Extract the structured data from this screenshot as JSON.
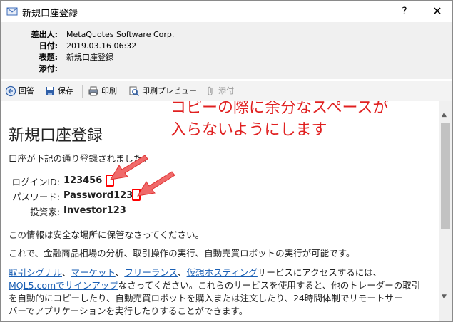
{
  "window": {
    "title": "新規口座登録",
    "help_label": "?",
    "close_label": "✕"
  },
  "header": {
    "from_label": "差出人:",
    "from_value": "MetaQuotes Software Corp.",
    "date_label": "日付:",
    "date_value": "2019.03.16 06:32",
    "subject_label": "表題:",
    "subject_value": "新規口座登録",
    "attach_label": "添付:",
    "attach_value": ""
  },
  "toolbar": {
    "reply_label": "回答",
    "reply_icon": "reply-icon",
    "save_label": "保存",
    "save_icon": "save-icon",
    "print_label": "印刷",
    "print_icon": "print-icon",
    "preview_label": "印刷プレビュー",
    "preview_icon": "print-preview-icon",
    "attach_label": "添付",
    "attach_icon": "paperclip-icon"
  },
  "annotation": {
    "line1": "コピーの際に余分なスペースが",
    "line2": "入らないようにします",
    "color": "#e02020"
  },
  "message": {
    "heading": "新規口座登録",
    "intro": "口座が下記の通り登録されました。",
    "login_label": "ログインID:",
    "login_value": "123456",
    "password_label": "パスワード:",
    "password_value": "Password123",
    "investor_label": "投資家:",
    "investor_value": "Investor123",
    "safety": "この情報は安全な場所に保管なさってください。",
    "features": "これで、金融商品相場の分析、取引操作の実行、自動売買ロボットの実行が可能です。",
    "link_signals": "取引シグナル",
    "sep1": "、",
    "link_market": "マーケット",
    "sep2": "、",
    "link_freelance": "フリーランス",
    "sep3": "、",
    "link_vps": "仮想ホスティング",
    "services_tail": "サービスにアクセスするには、",
    "link_mql5": "MQL5.comでサインアップ",
    "line2_tail": "なさってください。これらのサービスを使用すると、他のトレーダーの取引",
    "line3": "を自動的にコピーしたり、自動売買ロボットを購入または注文したり、24時間体制でリモートサー",
    "line4": "バーでアプリケーションを実行したりすることができます。"
  }
}
